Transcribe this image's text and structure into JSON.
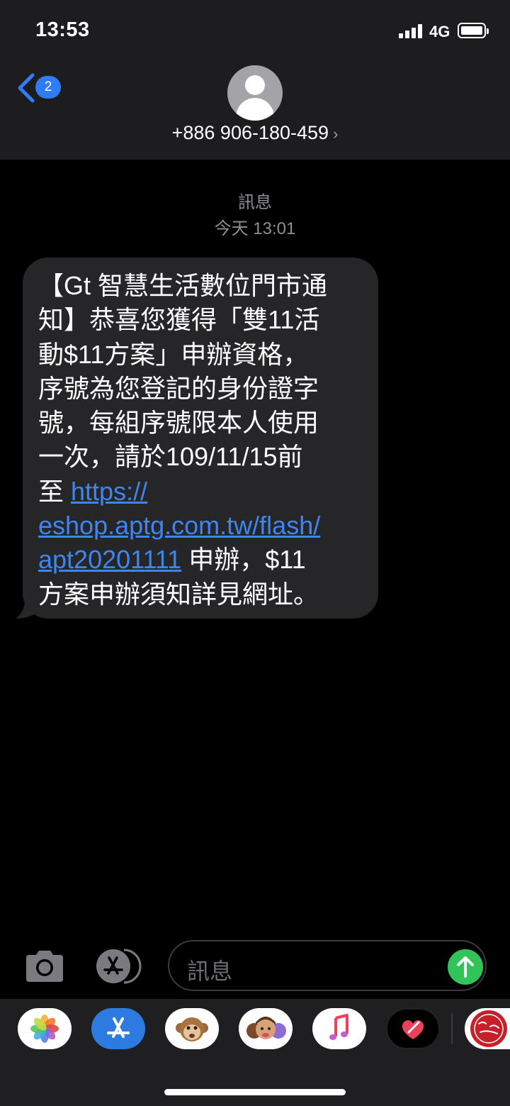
{
  "status_bar": {
    "time": "13:53",
    "network": "4G"
  },
  "header": {
    "back_badge": "2",
    "contact": "+886 906-180-459",
    "chevron": "›"
  },
  "conversation": {
    "service": "訊息",
    "timestamp": "今天 13:01"
  },
  "message": {
    "line1": "【Gt 智慧生活數位門市通",
    "line2": "知】恭喜您獲得「雙11活",
    "line3": "動$11方案」申辦資格，",
    "line4": "序號為您登記的身份證字",
    "line5": "號，每組序號限本人使用",
    "line6": "一次，請於109/11/15前",
    "line7_prefix": "至 ",
    "link1": "https://",
    "link2": "eshop.aptg.com.tw/flash/",
    "link3": "apt20201111",
    "line9_suffix": " 申辦，$11",
    "line10": "方案申辦須知詳見網址。"
  },
  "input": {
    "placeholder": "訊息"
  },
  "drawer_apps": [
    "photos-icon",
    "app-store-icon",
    "animoji-icon",
    "memoji-icon",
    "music-icon",
    "digital-touch-icon",
    "sticker-icon"
  ],
  "colors": {
    "accent": "#3d86f0",
    "send": "#31c459",
    "bubble": "#262628",
    "badge": "#2f7cf6"
  }
}
